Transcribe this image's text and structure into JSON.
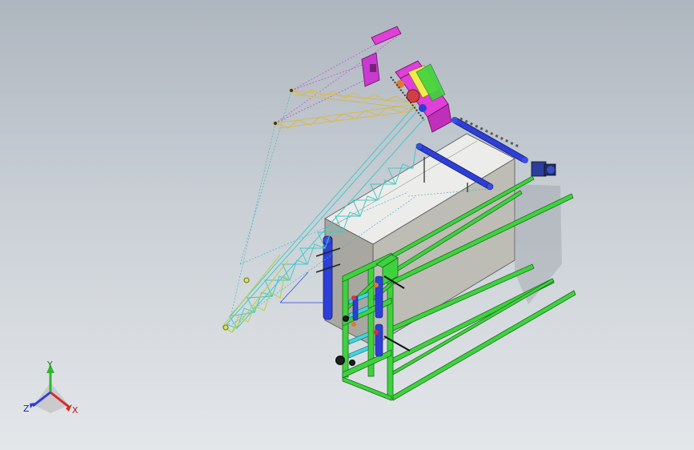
{
  "viewport": {
    "type": "3D CAD model view",
    "background_top": "#aeb6bf",
    "background_bottom": "#e4e7ea"
  },
  "model": {
    "parts": [
      {
        "name": "concrete-block",
        "color": "#d4d4cc"
      },
      {
        "name": "green-frame",
        "color": "#3fd23f"
      },
      {
        "name": "crane-boom-lattice",
        "color": "#44c7c7"
      },
      {
        "name": "upper-jib-lattice",
        "color": "#d9b94a"
      },
      {
        "name": "boom-tip-lattice",
        "color": "#b5d24a"
      },
      {
        "name": "crane-cab",
        "color": "#e03fd8"
      },
      {
        "name": "blue-beams",
        "color": "#2d3fd6"
      }
    ]
  },
  "triad": {
    "y_label": "Y",
    "x_label": "X",
    "z_label": "Z",
    "y_color": "#2fb52f",
    "x_color": "#d92a2a",
    "z_color": "#2a3fd9"
  }
}
